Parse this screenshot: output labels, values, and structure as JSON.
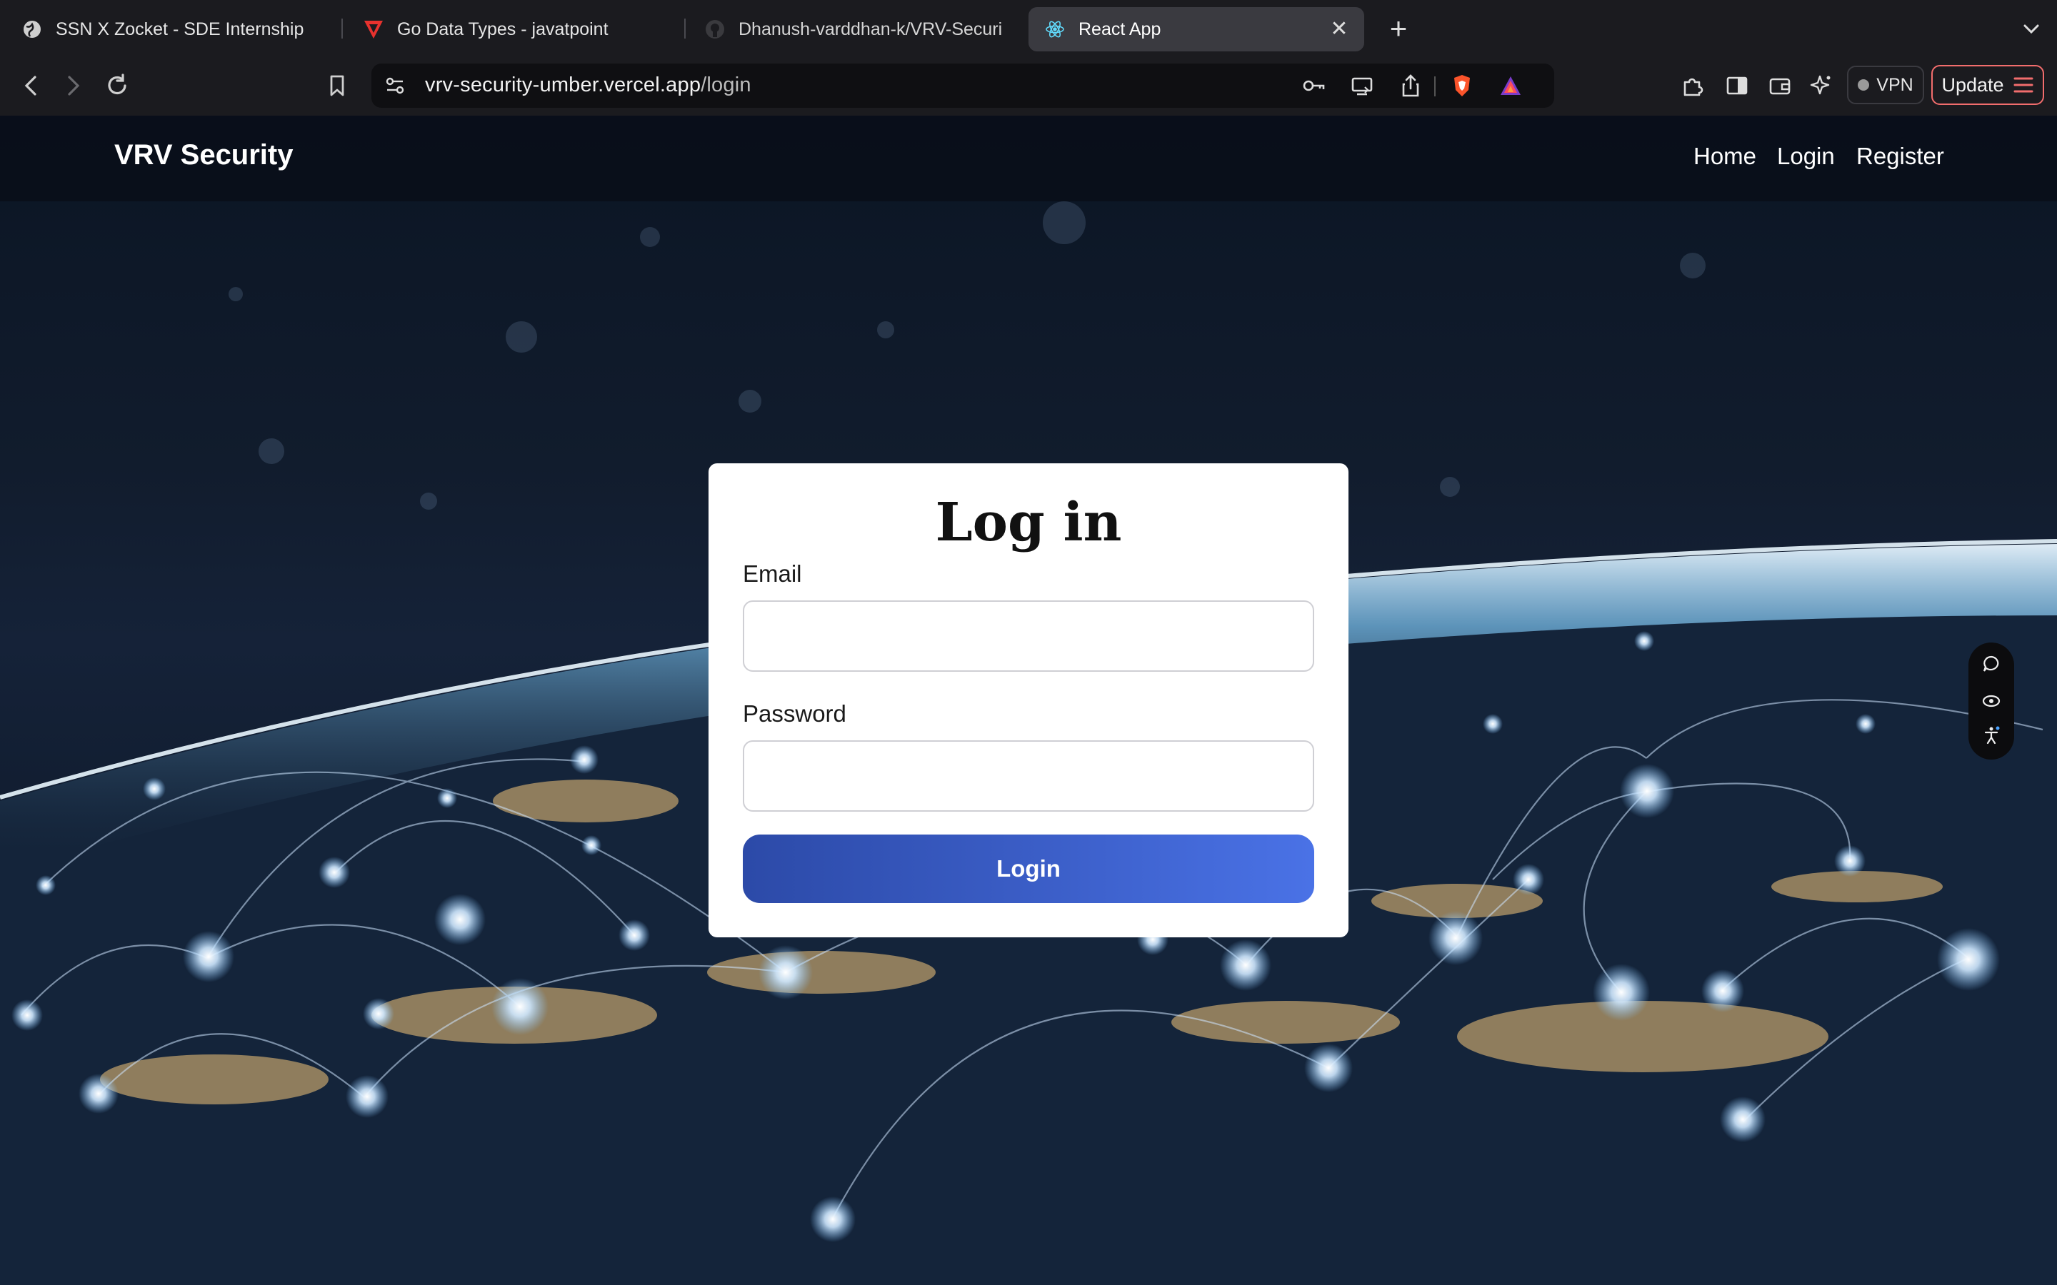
{
  "browser": {
    "tabs": [
      {
        "title": "SSN X Zocket - SDE Internship",
        "icon": "globe-icon"
      },
      {
        "title": "Go Data Types - javatpoint",
        "icon": "javatpoint-icon"
      },
      {
        "title": "Dhanush-varddhan-k/VRV-Securi",
        "icon": "github-icon"
      },
      {
        "title": "React App",
        "icon": "react-icon",
        "active": true
      }
    ],
    "url_host": "vrv-security-umber.vercel.app",
    "url_path": "/login",
    "vpn_label": "VPN",
    "update_label": "Update"
  },
  "site": {
    "brand": "VRV Security",
    "nav": {
      "home": "Home",
      "login": "Login",
      "register": "Register"
    }
  },
  "login_form": {
    "title": "Log in",
    "email_label": "Email",
    "email_value": "",
    "password_label": "Password",
    "password_value": "",
    "submit_label": "Login"
  },
  "colors": {
    "button_gradient_start": "#2c4aa8",
    "button_gradient_end": "#4a72e6",
    "update_border": "#f26d6d"
  }
}
